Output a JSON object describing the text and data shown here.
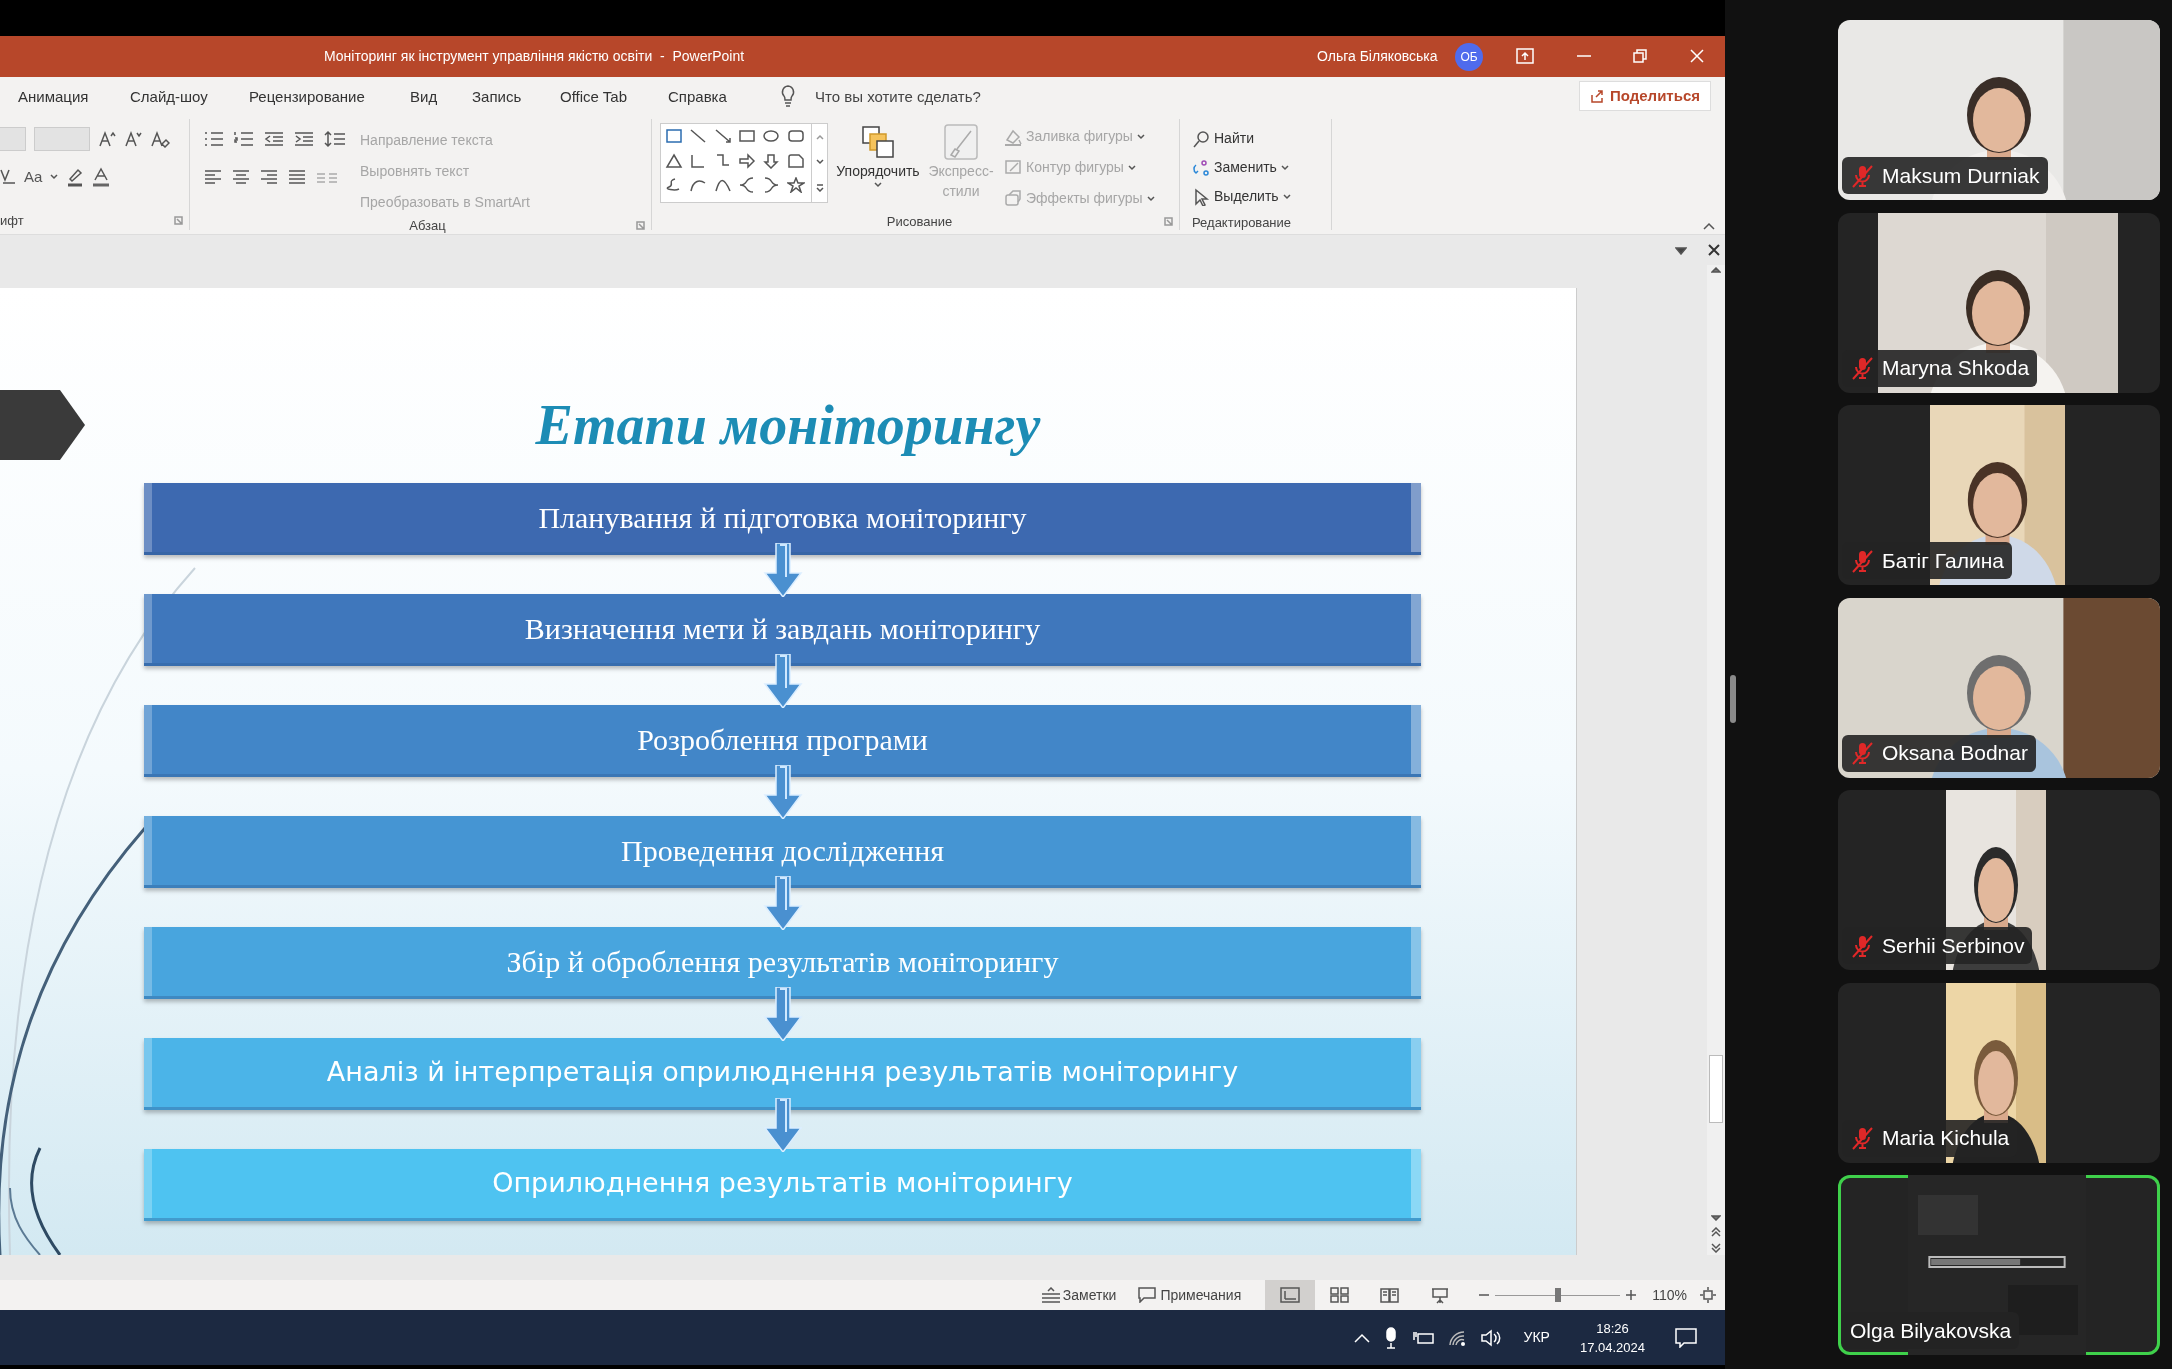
{
  "window": {
    "title": "Моніторинг як інструмент управління якістю освіти  -  PowerPoint",
    "user": "Ольга Біляковська",
    "avatar": "ОБ"
  },
  "ribbon_tabs": [
    "Анимация",
    "Слайд-шоу",
    "Рецензирование",
    "Вид",
    "Запись",
    "Office Tab",
    "Справка"
  ],
  "tell_me": "Что вы хотите сделать?",
  "share_button": "Поделиться",
  "ribbon": {
    "font_group": {
      "label": "ифт",
      "change_case": "Aa"
    },
    "paragraph": {
      "label": "Абзац",
      "commands": [
        {
          "label": "Направление текста",
          "disabled": true
        },
        {
          "label": "Выровнять текст",
          "disabled": true
        },
        {
          "label": "Преобразовать в SmartArt",
          "disabled": true
        }
      ]
    },
    "drawing": {
      "label": "Рисование",
      "arrange": "Упорядочить",
      "quick_styles": {
        "lines": [
          "Экспресс-",
          "стили"
        ],
        "disabled": true
      },
      "commands": [
        {
          "label": "Заливка фигуры",
          "disabled": true
        },
        {
          "label": "Контур фигуры",
          "disabled": true
        },
        {
          "label": "Эффекты фигуры",
          "disabled": true
        }
      ]
    },
    "editing": {
      "label": "Редактирование",
      "commands": [
        {
          "label": "Найти",
          "dropdown": false
        },
        {
          "label": "Заменить",
          "dropdown": true
        },
        {
          "label": "Выделить",
          "dropdown": true
        }
      ]
    }
  },
  "slide": {
    "title": "Етапи моніторингу",
    "steps": [
      {
        "text": "Планування й підготовка моніторингу",
        "kind": "serif"
      },
      {
        "text": "Визначення мети й завдань моніторингу",
        "kind": "serif"
      },
      {
        "text": "Розроблення програми",
        "kind": "serif"
      },
      {
        "text": "Проведення дослідження",
        "kind": "serif"
      },
      {
        "text": "Збір й оброблення результатів моніторингу",
        "kind": "serif"
      },
      {
        "text": "Аналіз й інтерпретація оприлюднення результатів моніторингу",
        "kind": "sans"
      },
      {
        "text": "Оприлюднення результатів моніторингу",
        "kind": "sans"
      }
    ]
  },
  "status_bar": {
    "notes": "Заметки",
    "comments": "Примечания",
    "views": [
      {
        "kind": "normal",
        "selected": true
      },
      {
        "kind": "sorter",
        "selected": false
      },
      {
        "kind": "reading",
        "selected": false
      },
      {
        "kind": "slideshow",
        "selected": false
      }
    ],
    "zoom_slider": {
      "level": 0.5
    },
    "zoom": "110%"
  },
  "taskbar": {
    "language": "УКР",
    "time": "18:26",
    "date": "17.04.2024"
  },
  "participants": [
    {
      "name": "Maksum Durniak",
      "muted": true,
      "speaking": false
    },
    {
      "name": "Maryna Shkoda",
      "muted": true,
      "speaking": false
    },
    {
      "name": "Батіг Галина",
      "muted": true,
      "speaking": false
    },
    {
      "name": "Oksana Bodnar",
      "muted": true,
      "speaking": false
    },
    {
      "name": "Serhii Serbinov",
      "muted": true,
      "speaking": false
    },
    {
      "name": "Maria Kichula",
      "muted": true,
      "speaking": false
    },
    {
      "name": "Olga Bilyakovska",
      "muted": false,
      "speaking": true
    }
  ]
}
